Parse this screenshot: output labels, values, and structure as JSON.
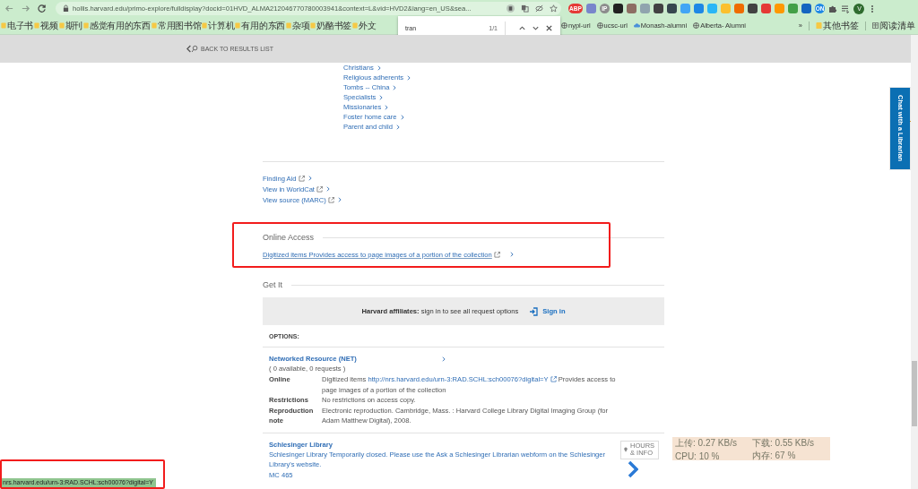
{
  "browser": {
    "url": "hollis.harvard.edu/primo-explore/fulldisplay?docid=01HVD_ALMA212046770780003941&context=L&vid=HVD2&lang=en_US&sea...",
    "profile_initial": "V",
    "extensions": [
      {
        "label": "ABP",
        "color": "#e53935"
      },
      {
        "color": "#7986cb"
      },
      {
        "label": "IP",
        "color": "#8c8c8c"
      },
      {
        "color": "#212121"
      },
      {
        "color": "#8d6e63"
      },
      {
        "color": "#90a4ae"
      },
      {
        "color": "#424242"
      },
      {
        "color": "#37474f"
      },
      {
        "color": "#42a5f5"
      },
      {
        "color": "#1e88e5"
      },
      {
        "color": "#29b6f6"
      },
      {
        "color": "#fbc02d"
      },
      {
        "color": "#ef6c00"
      },
      {
        "color": "#424242"
      },
      {
        "color": "#e53935"
      },
      {
        "color": "#ff9800"
      },
      {
        "color": "#43a047"
      },
      {
        "color": "#1565c0"
      },
      {
        "label": "ON",
        "color": "#1e88e5"
      }
    ],
    "bookmarks_left": [
      "电子书",
      "视频",
      "期刊",
      "感觉有用的东西",
      "常用图书馆",
      "计算机",
      "有用的东西",
      "杂项",
      "奶酪书签",
      "外文"
    ],
    "bookmarks_right": [
      {
        "kind": "globe",
        "label": "nypl-url"
      },
      {
        "kind": "globe",
        "label": "ucsc-url"
      },
      {
        "kind": "cloud",
        "label": "Monash-alumni"
      },
      {
        "kind": "globe",
        "label": "Alberta- Alumni"
      }
    ],
    "overflow": "»",
    "other_bookmarks": "其他书签",
    "reading_list": "阅读清单"
  },
  "find_bar": {
    "query": "tran",
    "count": "1/1"
  },
  "back_link": "BACK TO RESULTS LIST",
  "subjects": [
    "Christians",
    "Religious adherents",
    "Tombs -- China",
    "Specialists",
    "Missionaries",
    "Foster home care",
    "Parent and child"
  ],
  "links": [
    "Finding Aid",
    "View in WorldCat",
    "View source (MARC)"
  ],
  "online_access": {
    "heading": "Online Access",
    "link": "Digitized items Provides access to page images of a portion of the collection"
  },
  "get_it": {
    "heading": "Get It",
    "signin_notice": "**Harvard affiliates:** sign in to see all request options",
    "signin": "Sign in",
    "options_label": "OPTIONS:",
    "locations": [
      {
        "kind": "online",
        "name": "Networked Resource (NET)",
        "availability": "( 0 available, 0 requests )",
        "details": [
          {
            "label": "Online",
            "before": "Digitized items",
            "link": "http://nrs.harvard.edu/urn-3:RAD.SCHL:sch00076?digital=Y",
            "after": "Provides access to page images of a portion of the collection"
          },
          {
            "label": "Restrictions",
            "value": "No restrictions on access copy."
          },
          {
            "label": "Reproduction note",
            "value": "Electronic reproduction.  Cambridge, Mass. :  Harvard College Library Digital Imaging Group (for Adam Matthew Digital),  2008."
          }
        ]
      },
      {
        "kind": "library",
        "name": "Schlesinger Library",
        "hours_button": "HOURS & INFO",
        "note": "Schlesinger Library Temporarily closed. Please use the Ask a Schlesinger Librarian webform on the Schlesinger Library's website.",
        "call_number": "MC 465"
      }
    ]
  },
  "chat_tab": "Chat with a Librarian",
  "net_monitor": {
    "upload": "上传: 0.27 KB/s",
    "download": "下载: 0.55 KB/s",
    "cpu": "CPU: 10 %",
    "memory": "内存: 67 %"
  },
  "status_url": "nrs.harvard.edu/urn-3:RAD.SCHL:sch00076?digital=Y"
}
